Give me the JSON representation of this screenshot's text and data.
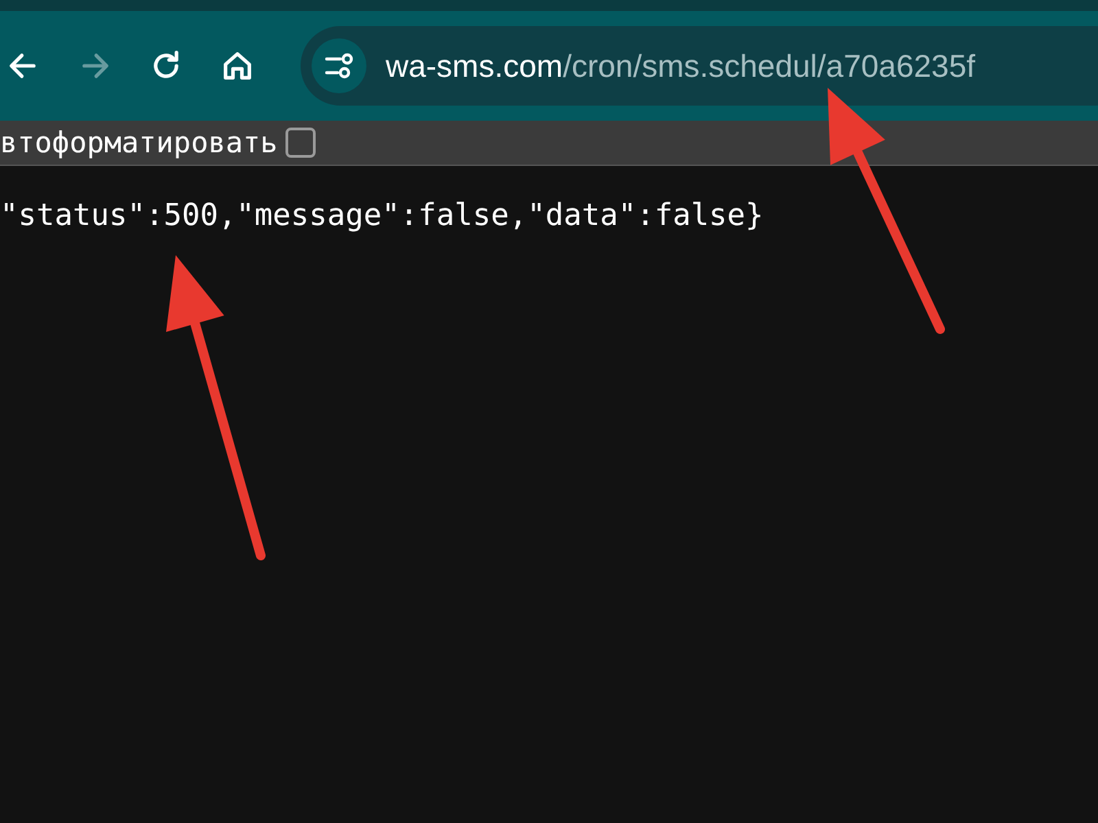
{
  "toolbar": {
    "buttons": [
      {
        "kind": "back",
        "disabled": false
      },
      {
        "kind": "forward",
        "disabled": true
      },
      {
        "kind": "reload",
        "disabled": false
      },
      {
        "kind": "home",
        "disabled": false
      }
    ]
  },
  "address_bar": {
    "host": "wa-sms.com",
    "path": "/cron/sms.schedul/a70a6235f"
  },
  "viewer": {
    "autoformat": {
      "label": "втоформатировать",
      "checked": false
    },
    "content": "\"status\":500,\"message\":false,\"data\":false}"
  },
  "annotations": [
    {
      "kind": "arrow"
    },
    {
      "kind": "arrow"
    }
  ]
}
